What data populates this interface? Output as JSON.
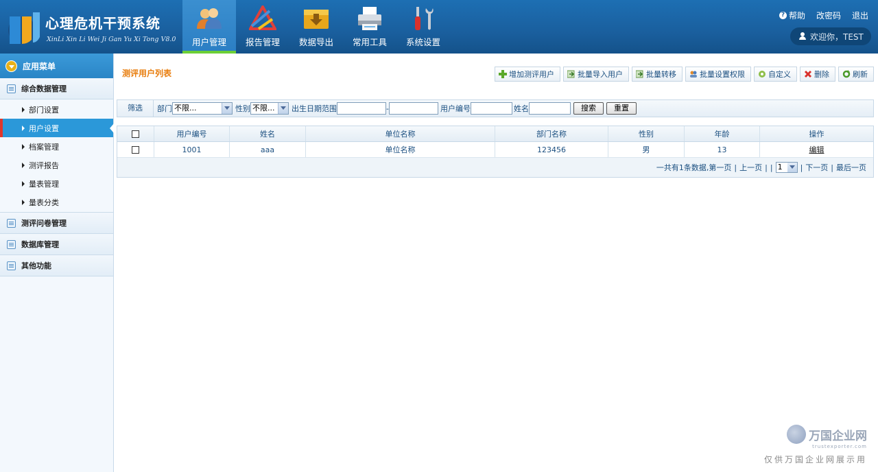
{
  "app": {
    "title": "心理危机干预系统",
    "subtitle": "XinLi Xin Li Wei Ji Gan Yu Xi Tong V8.0",
    "colors": {
      "header": "#1a5f9e",
      "active_tab": "#2b7ec3",
      "accent_green": "#6ccf36",
      "page_title": "#e87d0d",
      "sidebar_active": "#2b98d9"
    }
  },
  "nav": [
    {
      "label": "用户管理",
      "icon": "users-icon",
      "active": true
    },
    {
      "label": "报告管理",
      "icon": "report-icon",
      "active": false
    },
    {
      "label": "数据导出",
      "icon": "export-icon",
      "active": false
    },
    {
      "label": "常用工具",
      "icon": "printer-icon",
      "active": false
    },
    {
      "label": "系统设置",
      "icon": "tools-icon",
      "active": false
    }
  ],
  "topright": {
    "help": "帮助",
    "change_password": "改密码",
    "logout": "退出",
    "welcome": "欢迎你，TEST"
  },
  "sidebar": {
    "header": "应用菜单",
    "groups": [
      {
        "label": "综合数据管理",
        "items": [
          "部门设置",
          "用户设置",
          "档案管理",
          "测评报告",
          "量表管理",
          "量表分类"
        ],
        "active_item": 1
      },
      {
        "label": "测评问卷管理"
      },
      {
        "label": "数据库管理"
      },
      {
        "label": "其他功能"
      }
    ]
  },
  "main": {
    "title": "测评用户列表",
    "toolbar": [
      "增加测评用户",
      "批量导入用户",
      "批量转移",
      "批量设置权限",
      "自定义",
      "删除",
      "刷新"
    ],
    "filter": {
      "label": "筛选",
      "dept_label": "部门",
      "dept_value": "不限...",
      "gender_label": "性别",
      "gender_value": "不限...",
      "birth_label": "出生日期范围",
      "range_sep": "-",
      "userno_label": "用户编号",
      "name_label": "姓名",
      "search": "搜索",
      "reset": "重置"
    },
    "table": {
      "columns": [
        "用户编号",
        "姓名",
        "单位名称",
        "部门名称",
        "性别",
        "年龄",
        "操作"
      ],
      "rows": [
        {
          "user_no": "1001",
          "name": "aaa",
          "unit": "单位名称",
          "dept": "123456",
          "gender": "男",
          "age": "13",
          "action": "编辑"
        }
      ]
    },
    "pager": {
      "summary": "一共有1条数据,第一页",
      "prev": "上一页",
      "page": "1",
      "next": "下一页",
      "last": "最后一页"
    }
  },
  "watermark": {
    "name": "万国企业网",
    "url": "trustexporter.com",
    "text": "仅供万国企业网展示用"
  }
}
